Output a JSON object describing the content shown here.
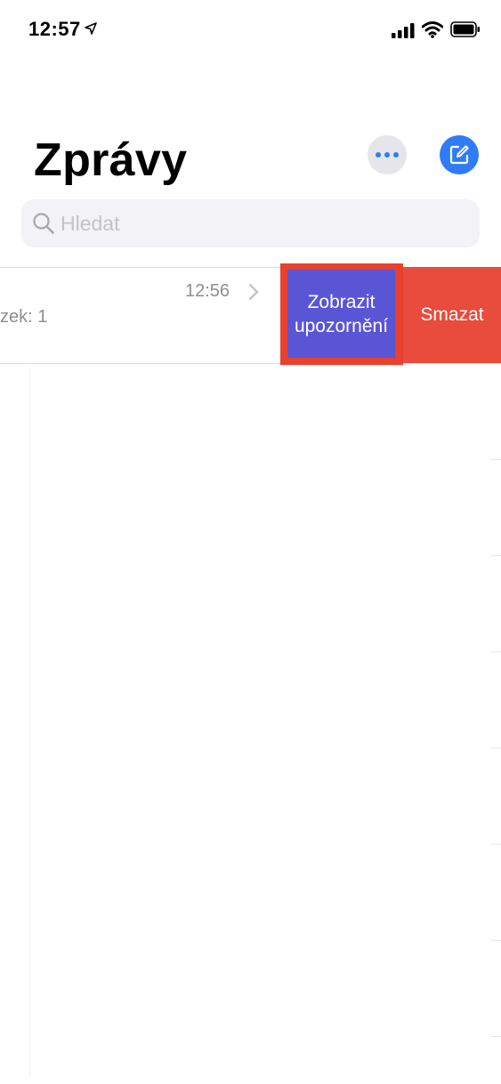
{
  "status_bar": {
    "time": "12:57"
  },
  "header": {
    "title": "Zprávy"
  },
  "search": {
    "placeholder": "Hledat",
    "value": ""
  },
  "conversation": {
    "time": "12:56",
    "preview": "zek: 1"
  },
  "swipe_actions": {
    "alerts_line1": "Zobrazit",
    "alerts_line2": "upozornění",
    "delete_label": "Smazat"
  },
  "colors": {
    "compose_blue": "#2f7cf6",
    "alerts_purple": "#5955d5",
    "delete_red": "#e94b3c",
    "highlight_red": "#e8412f"
  },
  "icons": {
    "location": "location-arrow-icon",
    "signal": "cellular-signal-icon",
    "wifi": "wifi-icon",
    "battery": "battery-icon",
    "more": "ellipsis-icon",
    "compose": "compose-icon",
    "search": "search-icon",
    "chevron": "chevron-right-icon"
  }
}
